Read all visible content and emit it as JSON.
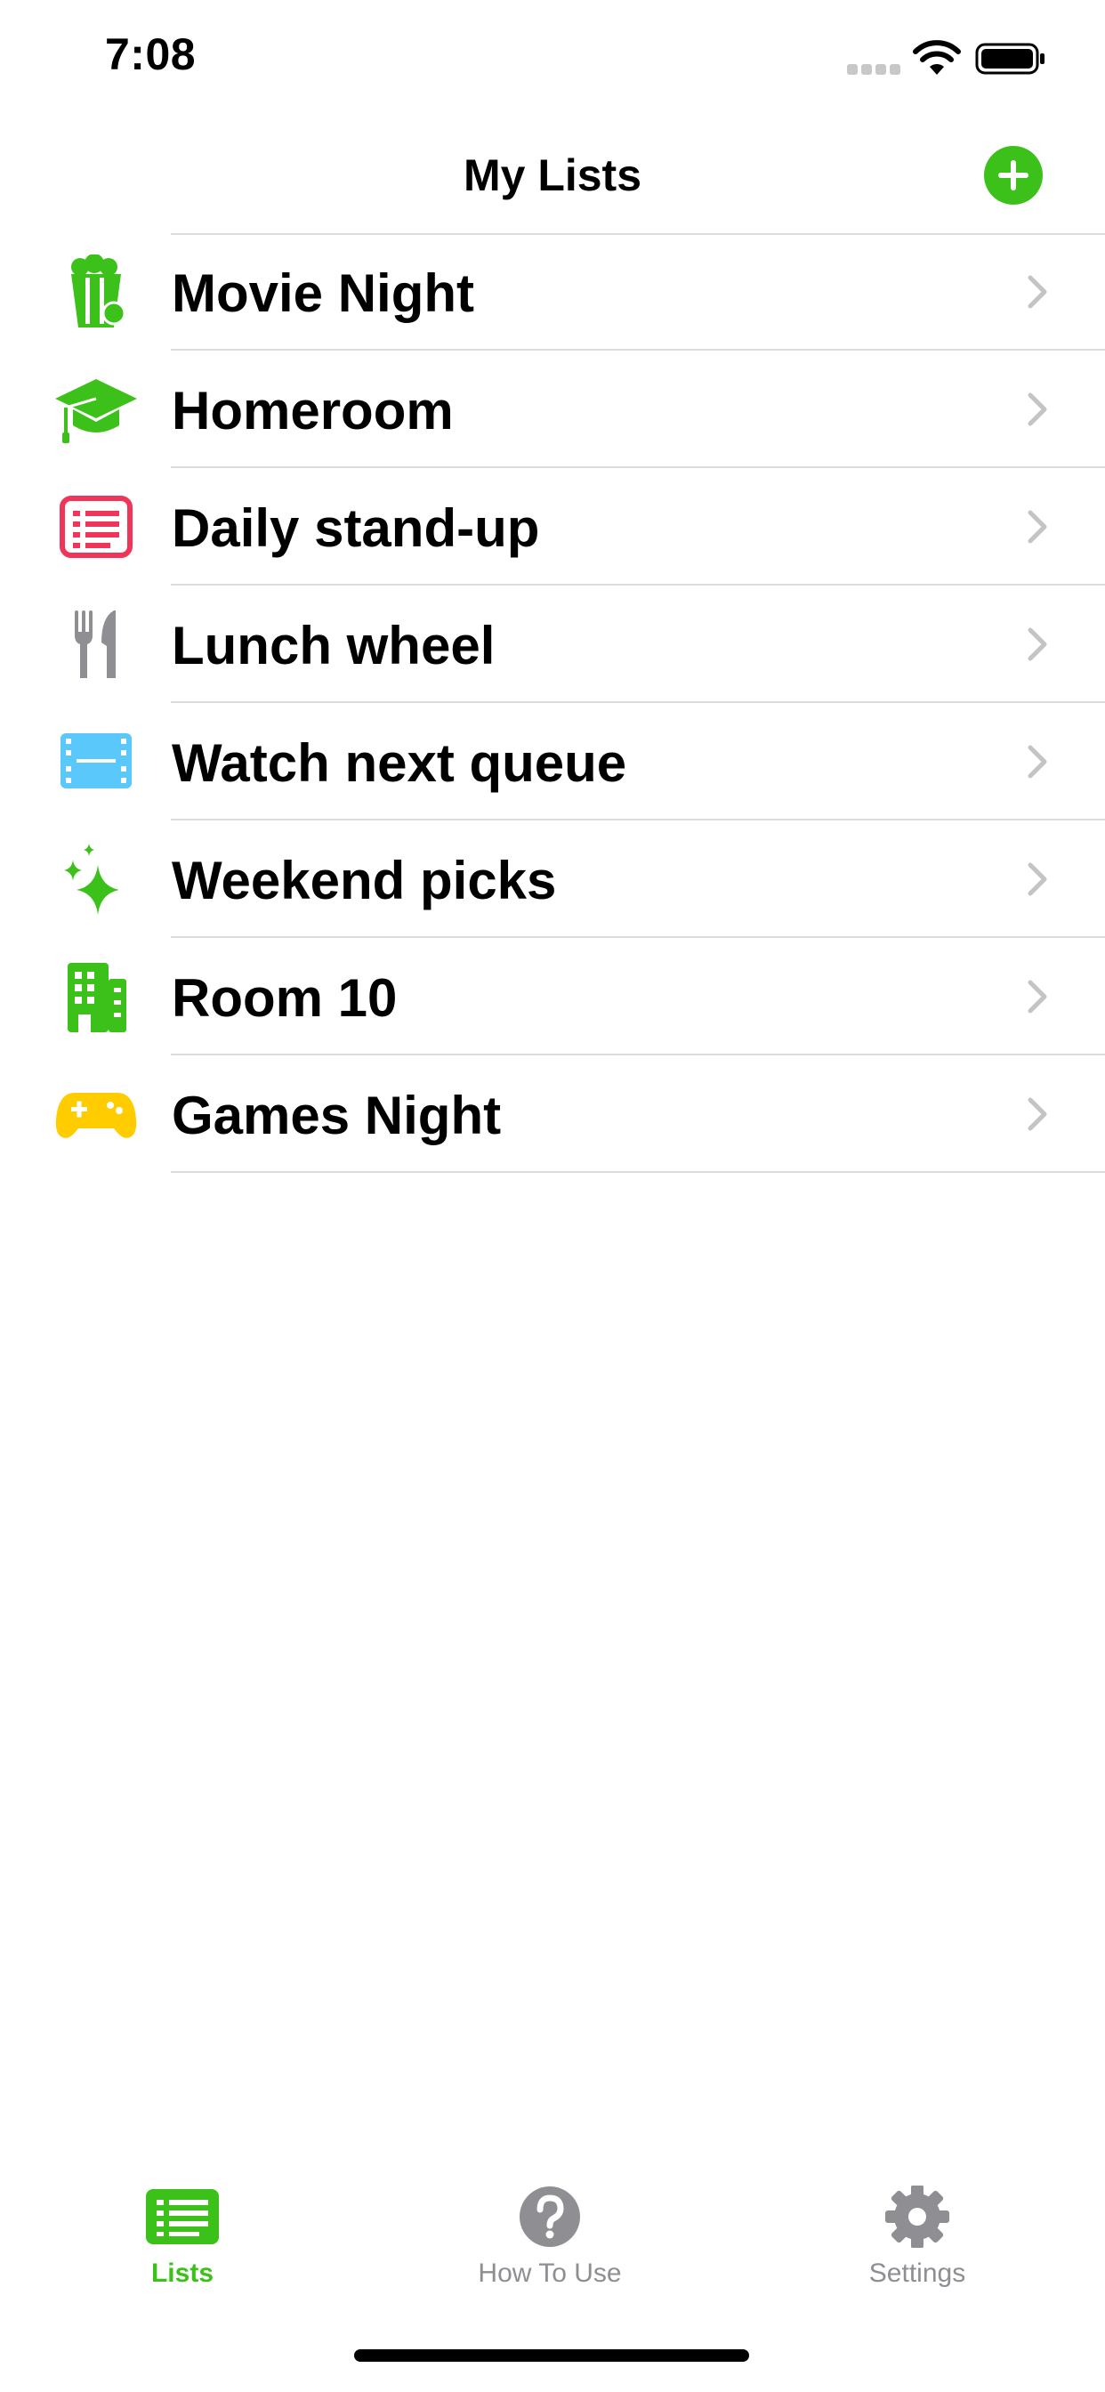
{
  "status_bar": {
    "time": "7:08",
    "icons": [
      "cellular-signal-icon",
      "wifi-icon",
      "battery-icon"
    ]
  },
  "nav": {
    "title": "My Lists",
    "add_icon": "plus-circle-icon"
  },
  "accent_color": "#3cc11a",
  "lists": [
    {
      "label": "Movie Night",
      "icon": "popcorn-icon",
      "color": "#3cc11a"
    },
    {
      "label": "Homeroom",
      "icon": "graduation-cap-icon",
      "color": "#3cc11a"
    },
    {
      "label": "Daily stand-up",
      "icon": "list-card-icon",
      "color": "#f0355a"
    },
    {
      "label": "Lunch wheel",
      "icon": "fork-knife-icon",
      "color": "#8e8e93"
    },
    {
      "label": "Watch next queue",
      "icon": "film-icon",
      "color": "#5ac8fa"
    },
    {
      "label": "Weekend picks",
      "icon": "sparkles-icon",
      "color": "#3cc11a"
    },
    {
      "label": "Room 10",
      "icon": "building-icon",
      "color": "#3cc11a"
    },
    {
      "label": "Games Night",
      "icon": "gamecontroller-icon",
      "color": "#ffcc00"
    }
  ],
  "tabs": [
    {
      "label": "Lists",
      "icon": "list-icon",
      "selected": true
    },
    {
      "label": "How To Use",
      "icon": "question-circle-icon",
      "selected": false
    },
    {
      "label": "Settings",
      "icon": "gear-icon",
      "selected": false
    }
  ]
}
